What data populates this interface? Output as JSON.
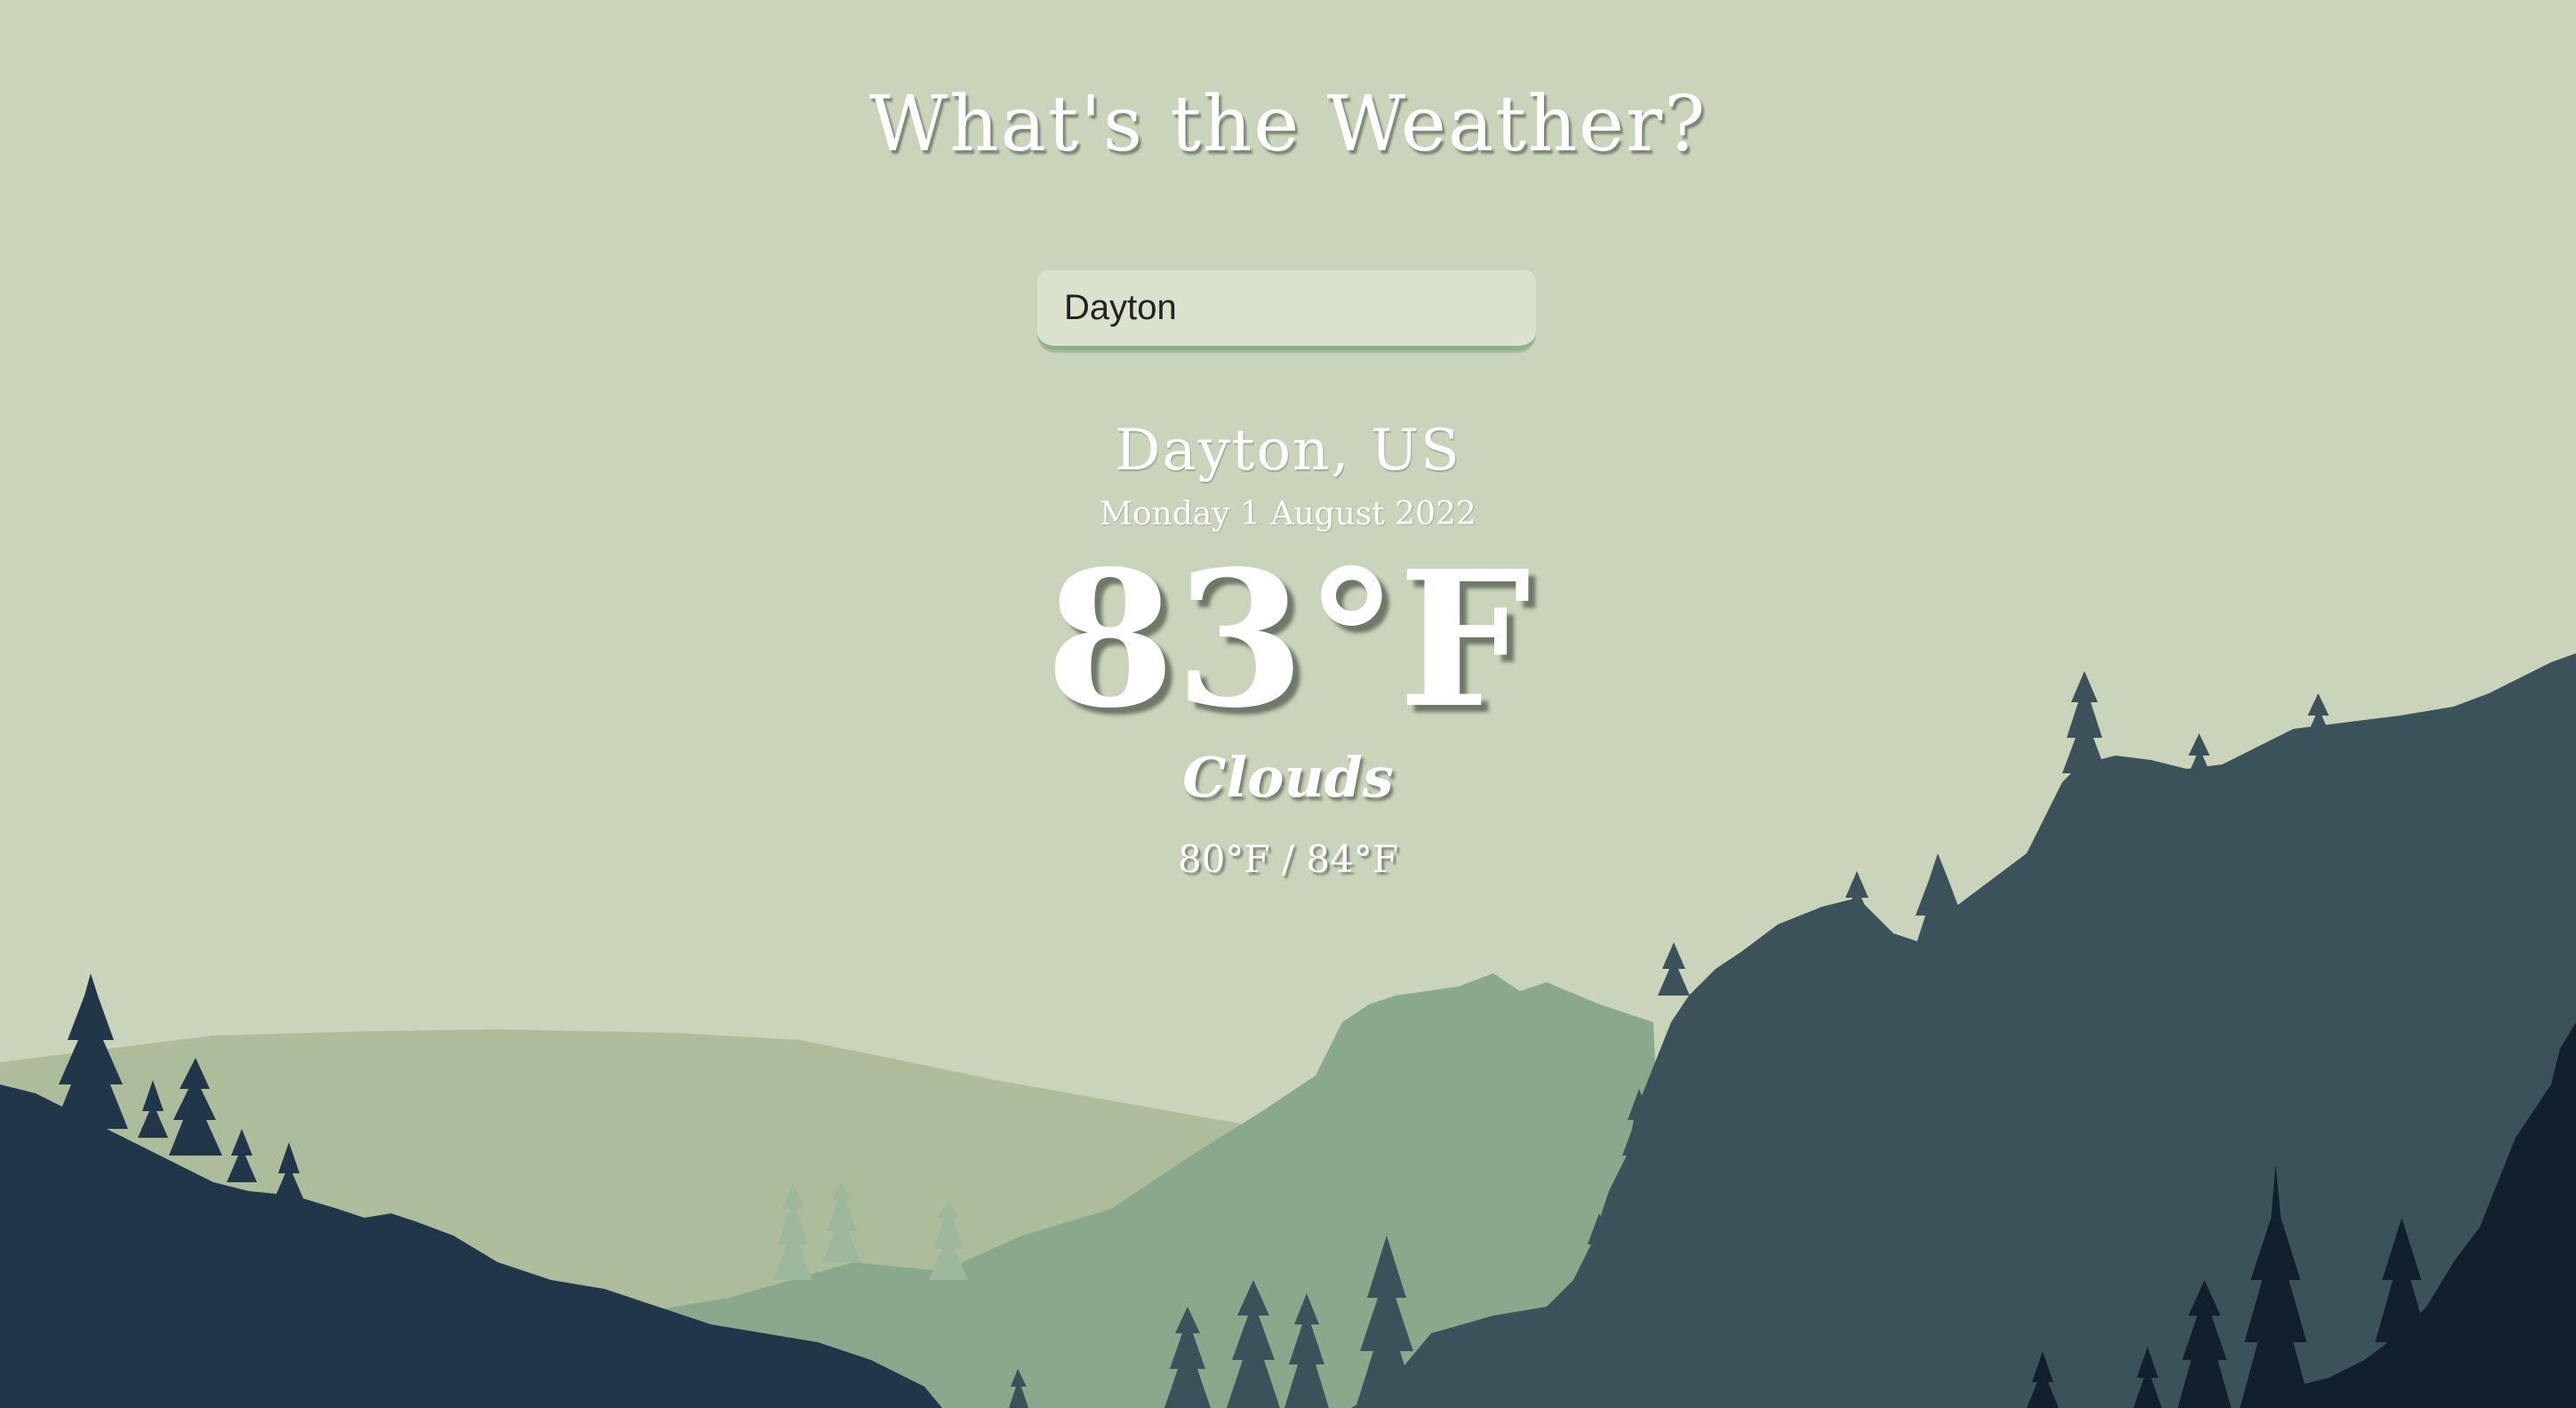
{
  "app": {
    "title": "What's the Weather?"
  },
  "search": {
    "value": "Dayton",
    "placeholder": ""
  },
  "weather": {
    "location": "Dayton, US",
    "date": "Monday 1 August 2022",
    "temperature": "83°F",
    "condition": "Clouds",
    "hi_low": "80°F / 84°F"
  },
  "colors": {
    "sky": "#c9d4ba",
    "far_hills": "#adbd9c",
    "mid_hills": "#8aa98c",
    "right_mountain": "#3c525a",
    "left_foreground": "#22364a",
    "far_right_trees": "#121f2d",
    "text": "#ffffff"
  }
}
